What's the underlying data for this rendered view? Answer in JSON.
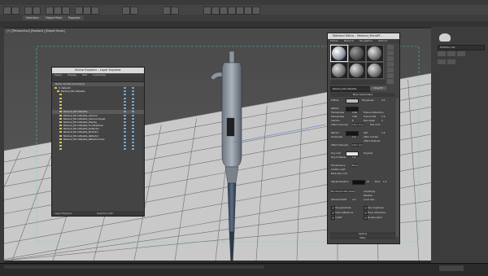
{
  "ribbon_tabs": [
    "Selection",
    "Object Paint",
    "Populate"
  ],
  "viewport": {
    "label": "[+] [Perspective] [Realistic] [Edged Faces]",
    "colors": {
      "ground": "#c9c9c9",
      "grid": "#6f6f6f",
      "pipette": "#7d8a99",
      "tip": "#3b4a5c"
    }
  },
  "scene_explorer": {
    "title": "Scene Explorer - Layer Explorer",
    "menu": [
      "Select",
      "Display",
      "Edit",
      "Customize"
    ],
    "header": "Name (Sorted Ascending)",
    "rows": [
      {
        "label": "0 (default)",
        "state": "normal"
      },
      {
        "label": "Medical_MicroPipette",
        "state": "normal"
      },
      {
        "label": "",
        "state": "dim"
      },
      {
        "label": "",
        "state": "dim"
      },
      {
        "label": "",
        "state": "dim"
      },
      {
        "label": "",
        "state": "dim"
      },
      {
        "label": "",
        "state": "dim"
      },
      {
        "label": "Medical_MicroPipette",
        "state": "sel"
      },
      {
        "label": "Medical_MicroPipette_Camera",
        "state": "normal"
      },
      {
        "label": "Medical_MicroPipette_Camera.Target",
        "state": "normal"
      },
      {
        "label": "Medical_MicroPipette_Display",
        "state": "normal"
      },
      {
        "label": "Medical_MicroPipette_FrontSkyFree",
        "state": "normal"
      },
      {
        "label": "Medical_MicroPipette_Defender",
        "state": "normal"
      },
      {
        "label": "Medical_MicroPipette_MidiCam",
        "state": "normal"
      },
      {
        "label": "Medical_MicroPipette_Reflector",
        "state": "normal"
      },
      {
        "label": "Medical_MicroPipette_ReflectorCube",
        "state": "normal"
      },
      {
        "label": "",
        "state": "dim"
      },
      {
        "label": "",
        "state": "dim"
      },
      {
        "label": "",
        "state": "dim"
      }
    ],
    "footer_left": "Layer Explorer",
    "footer_right": "Selection Set:"
  },
  "material_editor": {
    "title": "Material Editor - Medical_MicroPi...",
    "menu": [
      "Modes",
      "Material",
      "Navigation",
      "Options",
      "Utilities"
    ],
    "material_name": "Medical_MicroPipette",
    "material_type": "VRayMtl",
    "section_basic": "Basic parameters",
    "diffuse": {
      "label": "Diffuse",
      "color": "#bdbdbd",
      "roughness_label": "Roughness",
      "roughness": "0.0"
    },
    "reflect": {
      "label": "Reflect",
      "color": "#1a1a1a",
      "hilight_label": "HGlossiness",
      "hilight": "0.84",
      "rgloss_label": "RGlossiness",
      "rgloss": "0.86",
      "fresnel_label": "Fresnel reflections",
      "fresnel_ior_label": "Fresnel IOR",
      "fresnel_ior": "1.6",
      "subdivs_label": "Subdivs",
      "subdivs": "8",
      "max_depth_label": "Max depth",
      "max_depth": "5",
      "exit_label": "Exit color",
      "dim_label": "Dim distance",
      "affect_label": "Affect channels",
      "affect": "Color only"
    },
    "refract": {
      "label": "Refract",
      "color": "#151515",
      "ior_label": "IOR",
      "ior": "1.6",
      "gloss_label": "Glossiness",
      "gloss": "1.0",
      "abbe_label": "Abbe number",
      "abbe": "50.0",
      "affect_shadows": "Affect shadows",
      "affect_label": "Affect channels",
      "affect": "Color only"
    },
    "fog": {
      "label": "Fog color",
      "color": "#e8e8e8",
      "mult_label": "Fog multiplier",
      "mult": "1.0",
      "bias_label": "Fog bias",
      "bias": "0.0"
    },
    "translucency": {
      "label": "Translucency",
      "value": "None",
      "scatter_label": "Scatter coeff",
      "back_label": "Back-side color",
      "light_label": "Light multiplier"
    },
    "self_illum": {
      "label": "Self-illumination",
      "color": "#101010",
      "gi_label": "GI",
      "mult_label": "Mult",
      "mult": "1.0"
    },
    "brdf": {
      "label": "Microfacet GTR (GGX)",
      "aniso_label": "Anisotropy",
      "aniso": "0.0",
      "rotation_label": "Rotation",
      "rotation": "0.0",
      "gtr_label": "GTR tail falloff",
      "gtr": "2.0",
      "local_axis_label": "Local axis"
    },
    "options_labels": [
      "Use glossiness",
      "Use roughness",
      "Trace reflections",
      "Trace refractions",
      "Cutoff",
      "Double-sided"
    ],
    "rollouts": [
      "Options",
      "Maps"
    ]
  },
  "right_panel": {
    "title": "Modifier List"
  }
}
